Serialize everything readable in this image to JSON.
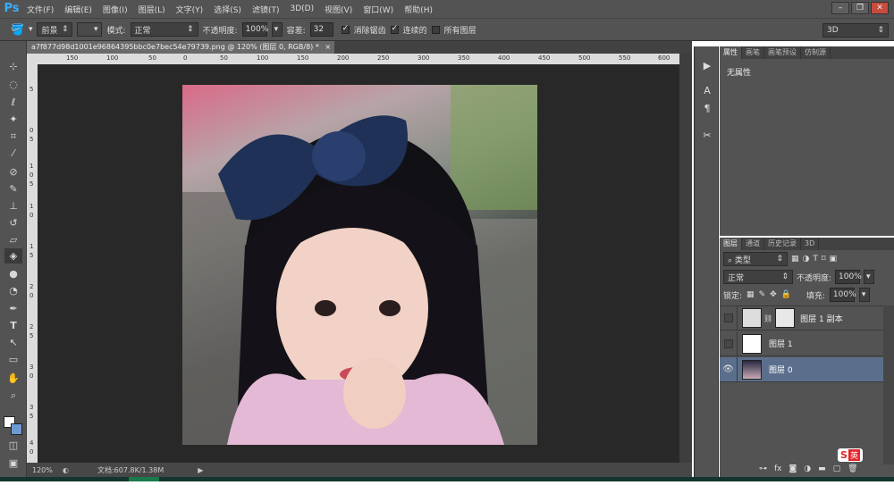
{
  "app": {
    "logo": "Ps"
  },
  "menu": [
    "文件(F)",
    "编辑(E)",
    "图像(I)",
    "图层(L)",
    "文字(Y)",
    "选择(S)",
    "滤镜(T)",
    "3D(D)",
    "视图(V)",
    "窗口(W)",
    "帮助(H)"
  ],
  "window_controls": {
    "minimize": "–",
    "restore": "❐",
    "close": "✕"
  },
  "options": {
    "fill_source": "前景",
    "mode_label": "模式:",
    "mode_value": "正常",
    "opacity_label": "不透明度:",
    "opacity_value": "100%",
    "tolerance_label": "容差:",
    "tolerance_value": "32",
    "antialias_label": "消除锯齿",
    "contiguous_label": "连续的",
    "all_layers_label": "所有图层",
    "workspace": "3D"
  },
  "document": {
    "tab_title": "a7f877d98d1001e96864395bbc0e7bec54e79739.png @ 120% (图层 0, RGB/8) *",
    "tab_close": "×",
    "ruler_ticks": [
      "150",
      "100",
      "50",
      "0",
      "50",
      "100",
      "150",
      "200",
      "250",
      "300",
      "350",
      "400",
      "450",
      "500",
      "550",
      "600"
    ],
    "ruler_v_ticks": [
      "5",
      "0",
      "5",
      "1",
      "0",
      "5",
      "1",
      "0",
      "1",
      "5",
      "2",
      "0",
      "2",
      "5",
      "3",
      "0",
      "3",
      "5",
      "4",
      "0"
    ]
  },
  "status": {
    "zoom": "120%",
    "doc_info": "文档:607.8K/1.38M"
  },
  "properties": {
    "tabs": [
      "属性",
      "画笔",
      "画笔预设",
      "仿制源"
    ],
    "content": "无属性"
  },
  "layers_panel": {
    "tabs": [
      "图层",
      "通道",
      "历史记录",
      "3D"
    ],
    "filter_kind": "类型",
    "blend_mode": "正常",
    "opacity_label": "不透明度:",
    "opacity_value": "100%",
    "lock_label": "锁定:",
    "fill_label": "填充:",
    "fill_value": "100%",
    "layers": [
      {
        "name": "图层 1 副本",
        "visible": false,
        "selected": false
      },
      {
        "name": "图层 1",
        "visible": false,
        "selected": false
      },
      {
        "name": "图层 0",
        "visible": true,
        "selected": true
      }
    ]
  },
  "ime": {
    "label": "英"
  },
  "colors": {
    "panel": "#535353",
    "canvas_bg": "#282828",
    "selected_layer": "#5b6f8c",
    "accent": "#3ab0ff"
  }
}
